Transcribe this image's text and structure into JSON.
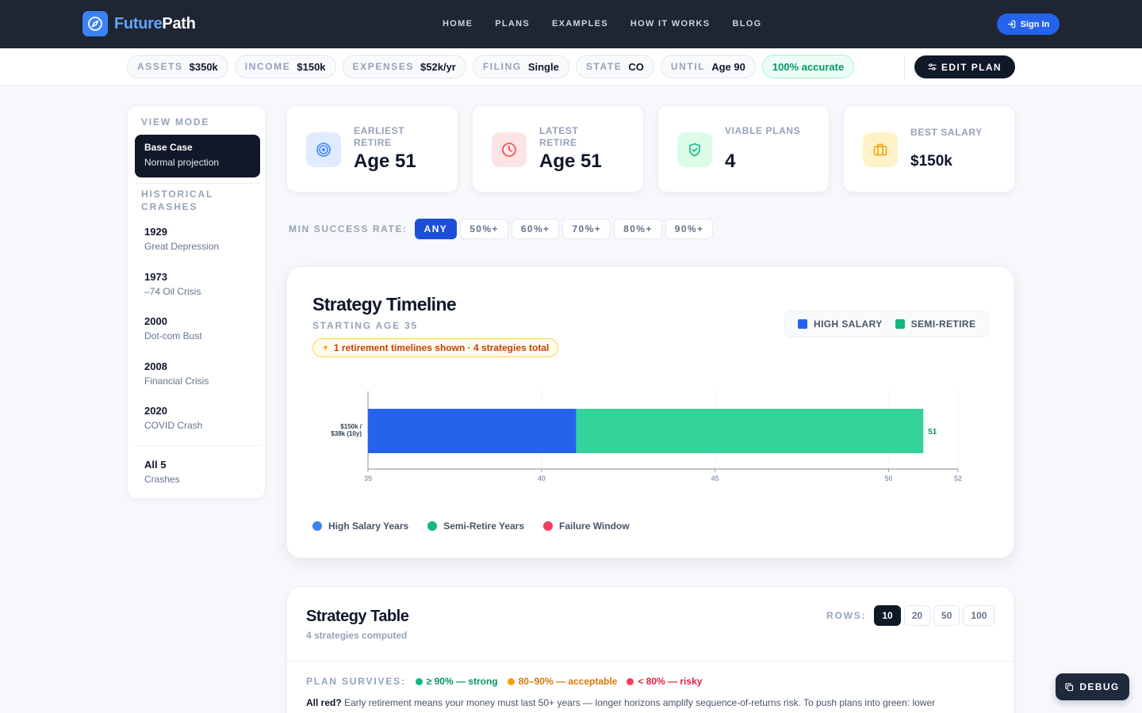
{
  "brand": {
    "part1": "Future",
    "part2": "Path"
  },
  "nav": {
    "items": [
      "HOME",
      "PLANS",
      "EXAMPLES",
      "HOW IT WORKS",
      "BLOG"
    ],
    "signin": "Sign In"
  },
  "summary": {
    "chips": [
      {
        "k": "ASSETS",
        "v": "$350k"
      },
      {
        "k": "INCOME",
        "v": "$150k"
      },
      {
        "k": "EXPENSES",
        "v": "$52k/yr"
      },
      {
        "k": "FILING",
        "v": "Single"
      },
      {
        "k": "STATE",
        "v": "CO"
      },
      {
        "k": "UNTIL",
        "v": "Age 90"
      }
    ],
    "accuracy": "100% accurate",
    "edit_plan": "EDIT PLAN"
  },
  "sidebar": {
    "view_mode": "VIEW MODE",
    "active": {
      "title": "Base Case",
      "desc": "Normal projection"
    },
    "historical": "HISTORICAL CRASHES",
    "crashes": [
      {
        "year": "1929",
        "desc": "Great Depression"
      },
      {
        "year": "1973",
        "desc": "–74 Oil Crisis"
      },
      {
        "year": "2000",
        "desc": "Dot-com Bust"
      },
      {
        "year": "2008",
        "desc": "Financial Crisis"
      },
      {
        "year": "2020",
        "desc": "COVID Crash"
      }
    ],
    "all": {
      "title": "All 5",
      "desc": "Crashes"
    }
  },
  "stats": [
    {
      "label": "EARLIEST RETIRE",
      "value": "Age 51",
      "icon": "target-icon",
      "color": "#3b82f6",
      "bg": "#e0ebff"
    },
    {
      "label": "LATEST RETIRE",
      "value": "Age 51",
      "icon": "clock-icon",
      "color": "#ef4444",
      "bg": "#fde4e4"
    },
    {
      "label": "VIABLE PLANS",
      "value": "4",
      "icon": "shield-check-icon",
      "color": "#10b981",
      "bg": "#dcfce7"
    },
    {
      "label": "BEST SALARY",
      "value": "$150k",
      "icon": "briefcase-icon",
      "color": "#f59e0b",
      "bg": "#fef3c7"
    }
  ],
  "filters": {
    "label": "MIN SUCCESS RATE:",
    "options": [
      "ANY",
      "50%+",
      "60%+",
      "70%+",
      "80%+",
      "90%+"
    ],
    "selected": "ANY"
  },
  "timeline": {
    "title": "Strategy Timeline",
    "subtitle": "STARTING AGE 35",
    "badge": "1 retirement timelines shown · 4 strategies total",
    "legend": [
      {
        "name": "HIGH SALARY",
        "color": "#2563eb"
      },
      {
        "name": "SEMI-RETIRE",
        "color": "#10b981"
      }
    ],
    "bottom_legend": [
      {
        "name": "High Salary Years",
        "color": "#3b82f6"
      },
      {
        "name": "Semi-Retire Years",
        "color": "#10b981"
      },
      {
        "name": "Failure Window",
        "color": "#f43f5e"
      }
    ]
  },
  "chart_data": {
    "type": "bar",
    "orientation": "horizontal-stacked",
    "xlim": [
      35,
      52
    ],
    "xticks": [
      "35",
      "40",
      "45",
      "50",
      "52"
    ],
    "rows": [
      {
        "label_line1": "$150k /",
        "label_line2": "$38k (10y)",
        "segments": [
          {
            "series": "High Salary",
            "start": 35,
            "end": 41,
            "color": "#2563eb"
          },
          {
            "series": "Semi-Retire",
            "start": 41,
            "end": 51,
            "color": "#34d399"
          }
        ],
        "end_label": "51"
      }
    ]
  },
  "table": {
    "title": "Strategy Table",
    "subtitle": "4 strategies computed",
    "rows_label": "ROWS:",
    "rows_options": [
      "10",
      "20",
      "50",
      "100"
    ],
    "rows_selected": "10",
    "survives_label": "PLAN SURVIVES:",
    "survives": [
      {
        "text": "≥ 90% — strong",
        "color": "#10b981"
      },
      {
        "text": "80–90% — acceptable",
        "color": "#f59e0b"
      },
      {
        "text": "< 80% — risky",
        "color": "#f43f5e"
      }
    ],
    "note_bold": "All red?",
    "note": " Early retirement means your money must last 50+ years — longer horizons amplify sequence-of-returns risk. To push plans into green: lower"
  },
  "debug": "DEBUG"
}
